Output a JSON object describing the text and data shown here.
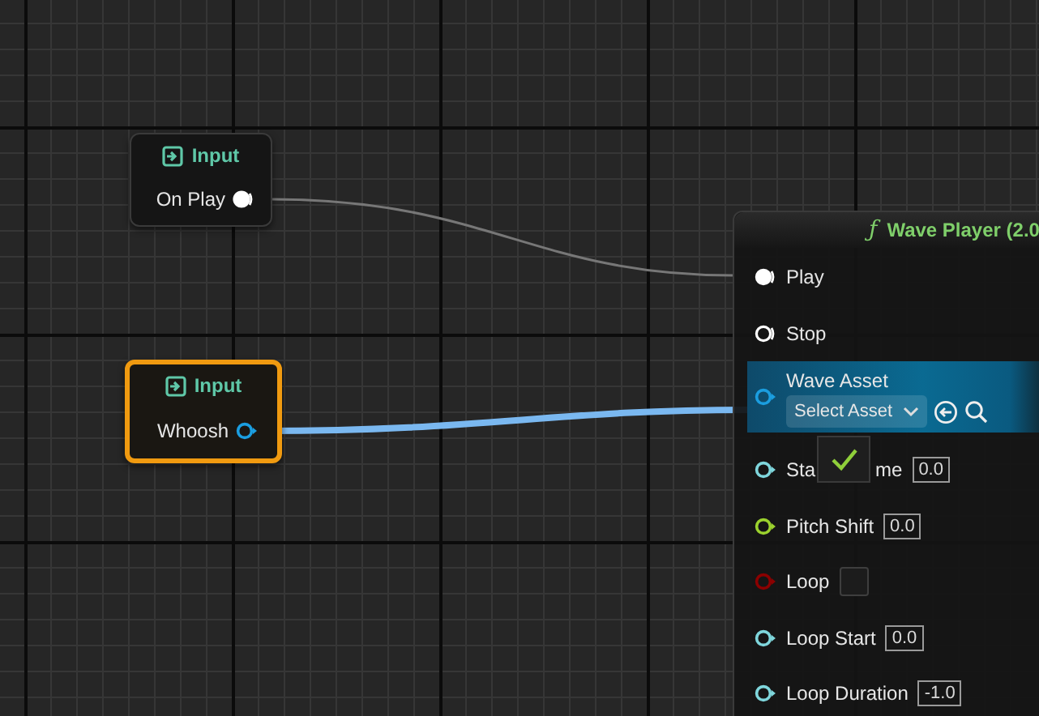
{
  "inputs": [
    {
      "title": "Input",
      "selected": false,
      "pin": {
        "label": "On Play",
        "kind": "exec",
        "connected": true,
        "color": "#ffffff"
      }
    },
    {
      "title": "Input",
      "selected": true,
      "pin": {
        "label": "Whoosh",
        "kind": "data",
        "color": "#1b9ee0"
      }
    }
  ],
  "wave_player": {
    "glyph": "ƒ",
    "title": "Wave Player (2.0",
    "pins": [
      {
        "kind": "exec",
        "label": "Play",
        "connected": true,
        "color": "#ffffff"
      },
      {
        "kind": "exec",
        "label": "Stop",
        "connected": false,
        "color": "#ffffff"
      },
      {
        "kind": "asset",
        "label": "Wave Asset",
        "value": "Select Asset",
        "color": "#1b9ee0"
      },
      {
        "kind": "value",
        "label": "Sta",
        "label_after": "me",
        "value": "0.0",
        "color": "#7fd6dc"
      },
      {
        "kind": "value",
        "label": "Pitch Shift",
        "value": "0.0",
        "color": "#9bd22e"
      },
      {
        "kind": "bool",
        "label": "Loop",
        "checked": false,
        "color": "#8b0000"
      },
      {
        "kind": "value",
        "label": "Loop Start",
        "value": "0.0",
        "color": "#7fd6dc"
      },
      {
        "kind": "value",
        "label": "Loop Duration",
        "value": "-1.0",
        "color": "#7fd6dc"
      }
    ]
  },
  "floating_checkbox": {
    "checked": true
  }
}
